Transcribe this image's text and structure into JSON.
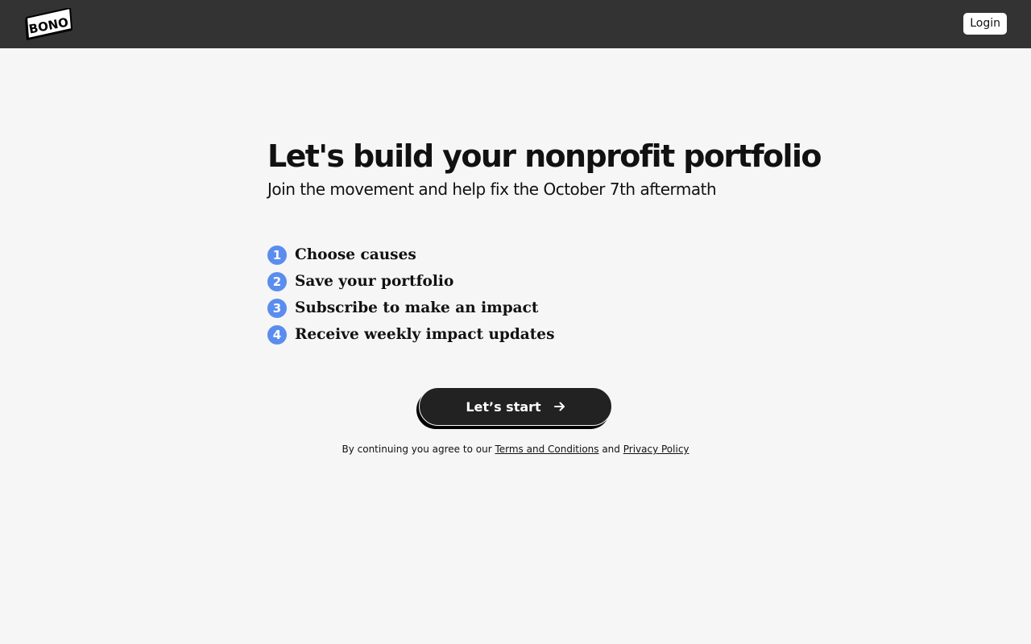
{
  "header": {
    "logo_text": "BONO",
    "login_label": "Login"
  },
  "hero": {
    "title": "Let's build your nonprofit portfolio",
    "subtitle": "Join the movement and help fix the October 7th aftermath"
  },
  "steps": [
    {
      "number": "1",
      "label": "Choose causes"
    },
    {
      "number": "2",
      "label": "Save your portfolio"
    },
    {
      "number": "3",
      "label": "Subscribe to make an impact"
    },
    {
      "number": "4",
      "label": "Receive weekly impact updates"
    }
  ],
  "cta": {
    "label": "Let’s start",
    "icon": "arrow-right-icon"
  },
  "legal": {
    "prefix": "By continuing you agree to our ",
    "terms_link": "Terms and Conditions",
    "conjunction": " and ",
    "privacy_link": "Privacy Policy"
  },
  "colors": {
    "topbar": "#333333",
    "background": "#f6f6f6",
    "step_badge": "#5b8def",
    "button": "#222222"
  }
}
